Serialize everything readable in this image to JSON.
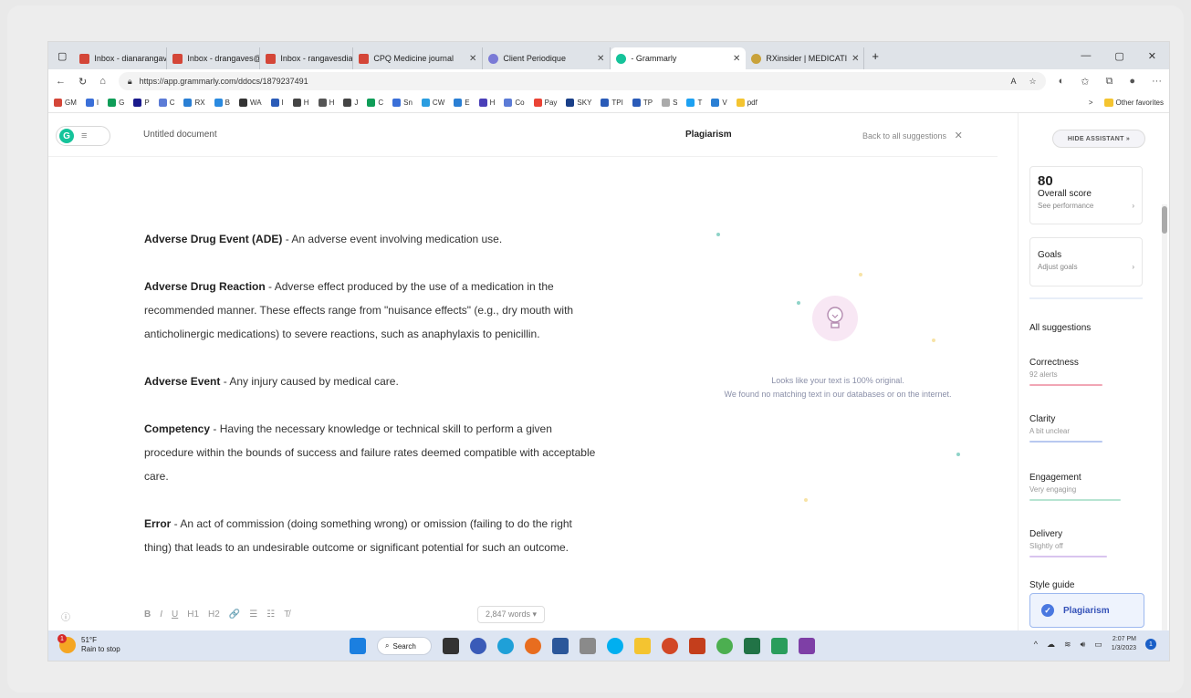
{
  "tabs": [
    {
      "label": "Inbox - dianarangave",
      "color": "#d44638"
    },
    {
      "label": "Inbox - drangaves@g",
      "color": "#d44638"
    },
    {
      "label": "Inbox - rangavesdian",
      "color": "#d44638"
    },
    {
      "label": "CPQ Medicine journal",
      "color": "#d44638"
    },
    {
      "label": "Client Periodique",
      "color": "#7a7ad6"
    },
    {
      "label": "- Grammarly",
      "color": "#15c39a",
      "active": true
    },
    {
      "label": "RXinsider | MEDICATI",
      "color": "#c9a23a"
    }
  ],
  "new_tab": "+",
  "url": "https://app.grammarly.com/ddocs/1879237491",
  "bookmarks": [
    "GM",
    "I",
    "G",
    "P",
    "C",
    "RX",
    "B",
    "WA",
    "I",
    "H",
    "H",
    "J",
    "C",
    "Sn",
    "CW",
    "E",
    "H",
    "Co",
    "Pay",
    "SKY",
    "TPI",
    "TP",
    "S",
    "T",
    "V",
    "pdf"
  ],
  "bookmarks_more": ">",
  "other_favorites": "Other favorites",
  "doc_title": "Untitled document",
  "entries": [
    {
      "term": "Adverse Drug Event (ADE)",
      "def": " - An adverse event involving medication use."
    },
    {
      "term": "Adverse Drug Reaction",
      "def": " - Adverse effect produced by the use of a medication in the recommended manner. These effects range from \"nuisance effects\" (e.g., dry mouth with anticholinergic medications) to severe reactions, such as anaphylaxis to penicillin."
    },
    {
      "term": "Adverse Event",
      "def": " - Any injury caused by medical care."
    },
    {
      "term": "Competency",
      "def": " - Having the necessary knowledge or technical skill to perform a given procedure within the bounds of success and failure rates deemed compatible with acceptable care."
    },
    {
      "term": "Error",
      "def": " - An act of commission (doing something wrong) or omission (failing to do the right thing) that leads to an undesirable outcome or significant potential for such an outcome."
    }
  ],
  "word_count": "2,847 words",
  "format_bar": {
    "bold": "B",
    "italic": "I",
    "underline": "U",
    "h1": "H1",
    "h2": "H2",
    "link": "🔗",
    "ol": "☰",
    "ul": "☷",
    "clear": "T̸"
  },
  "plagiarism": {
    "heading": "Plagiarism",
    "back": "Back to all suggestions",
    "msg1": "Looks like your text is 100% original.",
    "msg2": "We found no matching text in our databases or on the internet."
  },
  "assistant": {
    "hide_label": "HIDE ASSISTANT »",
    "score": "80",
    "score_title": "Overall score",
    "score_sub": "See performance",
    "goals_title": "Goals",
    "goals_sub": "Adjust goals",
    "all_suggestions": "All suggestions",
    "categories": [
      {
        "title": "Correctness",
        "sub": "92 alerts",
        "color": "#f1a6b5"
      },
      {
        "title": "Clarity",
        "sub": "A bit unclear",
        "color": "#b8c8f0"
      },
      {
        "title": "Engagement",
        "sub": "Very engaging",
        "color": "#b7e4d2"
      },
      {
        "title": "Delivery",
        "sub": "Slightly off",
        "color": "#d9c4ef"
      },
      {
        "title": "Style guide",
        "sub": "",
        "color": "#eee"
      }
    ],
    "plagiarism_button": "Plagiarism"
  },
  "taskbar": {
    "temp": "51°F",
    "weather": "Rain to stop",
    "notif_count": "1",
    "search": "Search",
    "time": "2:07 PM",
    "date": "1/3/2023",
    "notif_badge": "1"
  }
}
